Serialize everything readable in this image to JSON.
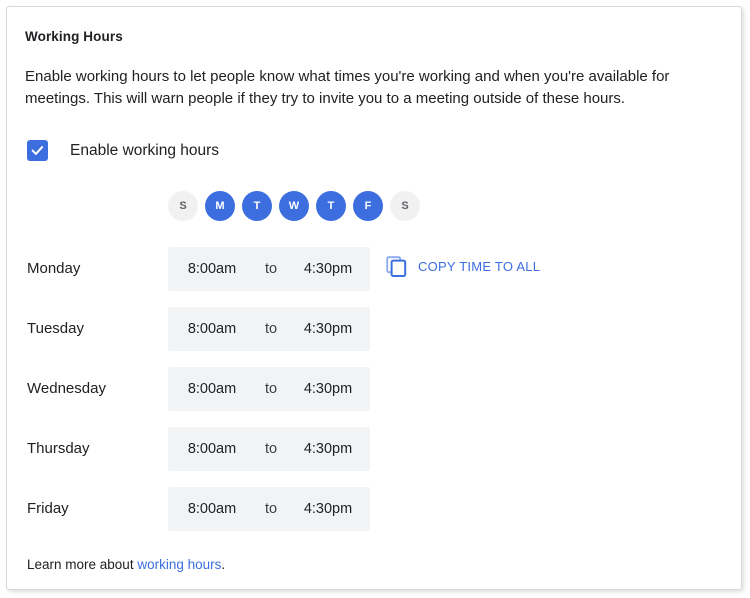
{
  "section": {
    "title": "Working Hours",
    "description": "Enable working hours to let people know what times you're working and when you're available for meetings. This will warn people if they try to invite you to a meeting outside of these hours."
  },
  "enable": {
    "label": "Enable working hours",
    "checked": true,
    "checkbox_color": "#3c6ee0"
  },
  "day_toggles": [
    {
      "letter": "S",
      "name": "sunday",
      "active": false
    },
    {
      "letter": "M",
      "name": "monday",
      "active": true
    },
    {
      "letter": "T",
      "name": "tuesday",
      "active": true
    },
    {
      "letter": "W",
      "name": "wednesday",
      "active": true
    },
    {
      "letter": "T",
      "name": "thursday",
      "active": true
    },
    {
      "letter": "F",
      "name": "friday",
      "active": true
    },
    {
      "letter": "S",
      "name": "saturday",
      "active": false
    }
  ],
  "toggle_colors": {
    "active_bg": "#3c6ee0",
    "active_text": "#ffffff",
    "inactive_bg": "#f1f1f1",
    "inactive_text": "#5f6368"
  },
  "separator_label": "to",
  "schedule": [
    {
      "day": "Monday",
      "start": "8:00am",
      "to": "to",
      "end": "4:30pm",
      "has_copy_action": true
    },
    {
      "day": "Tuesday",
      "start": "8:00am",
      "to": "to",
      "end": "4:30pm",
      "has_copy_action": false
    },
    {
      "day": "Wednesday",
      "start": "8:00am",
      "to": "to",
      "end": "4:30pm",
      "has_copy_action": false
    },
    {
      "day": "Thursday",
      "start": "8:00am",
      "to": "to",
      "end": "4:30pm",
      "has_copy_action": false
    },
    {
      "day": "Friday",
      "start": "8:00am",
      "to": "to",
      "end": "4:30pm",
      "has_copy_action": false
    }
  ],
  "copy_action": {
    "label": "COPY TIME TO ALL",
    "icon": "copy-icon",
    "color": "#3c6ee0"
  },
  "footer": {
    "prefix": "Learn more about ",
    "link_text": "working hours",
    "suffix": "."
  },
  "colors": {
    "accent": "#3c6ee0",
    "field_bg": "#f1f3f4",
    "text": "#202124",
    "card_bg": "#ffffff"
  }
}
